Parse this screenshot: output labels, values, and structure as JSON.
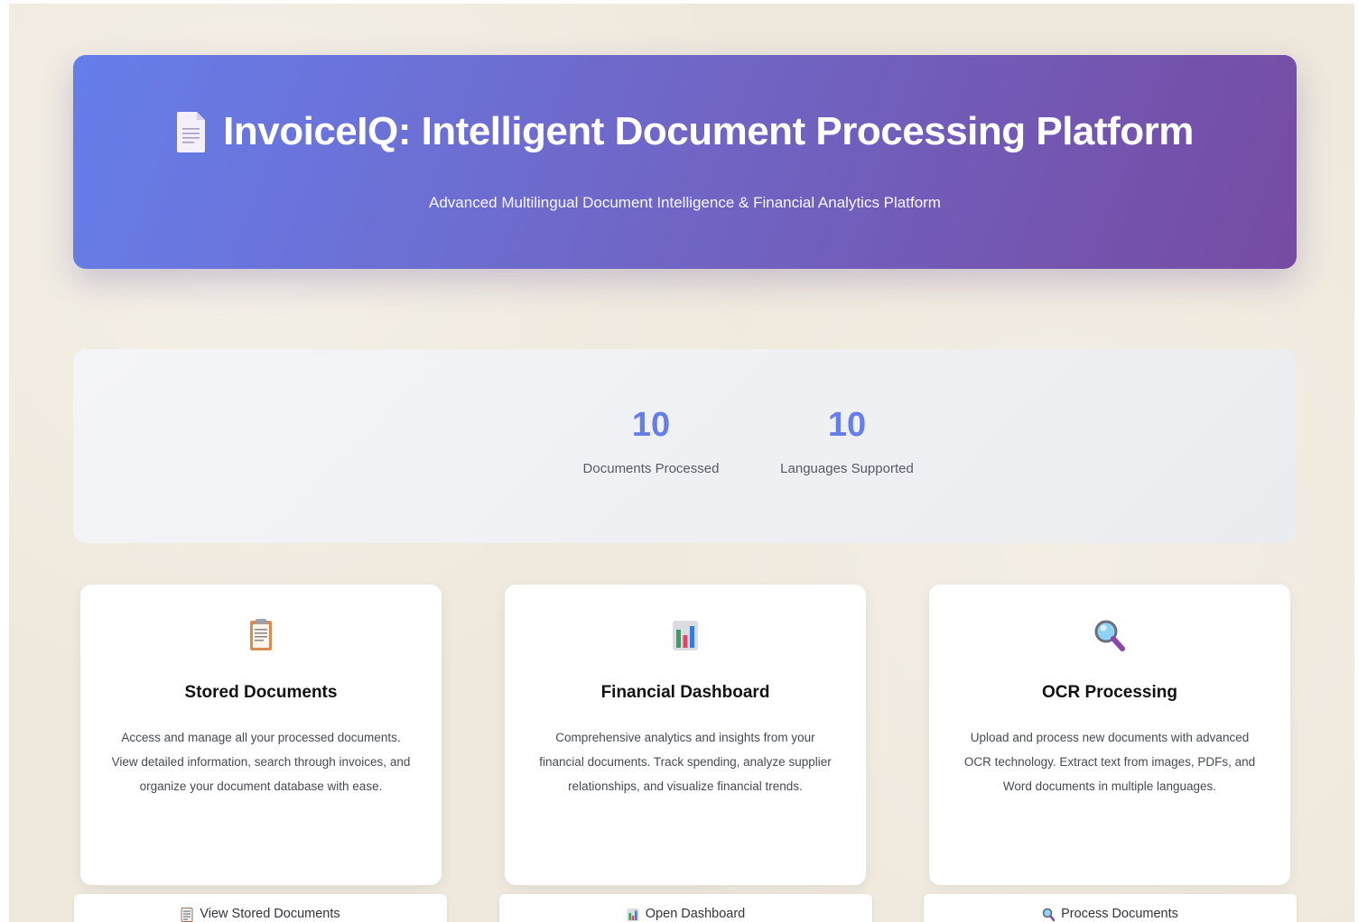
{
  "header": {
    "title": "InvoiceIQ: Intelligent Document Processing Platform",
    "subtitle": "Advanced Multilingual Document Intelligence & Financial Analytics Platform",
    "icon": "document-icon"
  },
  "stats": [
    {
      "value": "10",
      "label": "Documents Processed"
    },
    {
      "value": "10",
      "label": "Languages Supported"
    }
  ],
  "cards": [
    {
      "icon": "clipboard-icon",
      "title": "Stored Documents",
      "description": "Access and manage all your processed documents. View detailed information, search through invoices, and organize your document database with ease."
    },
    {
      "icon": "bar-chart-icon",
      "title": "Financial Dashboard",
      "description": "Comprehensive analytics and insights from your financial documents. Track spending, analyze supplier relationships, and visualize financial trends."
    },
    {
      "icon": "magnifying-glass-icon",
      "title": "OCR Processing",
      "description": "Upload and process new documents with advanced OCR technology. Extract text from images, PDFs, and Word documents in multiple languages."
    }
  ],
  "buttons": [
    {
      "icon": "receipt-icon",
      "label": "View Stored Documents"
    },
    {
      "icon": "bar-chart-icon",
      "label": "Open Dashboard"
    },
    {
      "icon": "magnifying-glass-icon",
      "label": "Process Documents"
    }
  ],
  "colors": {
    "header_gradient_start": "#667eea",
    "header_gradient_end": "#764ba2",
    "stat_value": "#667eea",
    "background": "#efe8dc"
  }
}
